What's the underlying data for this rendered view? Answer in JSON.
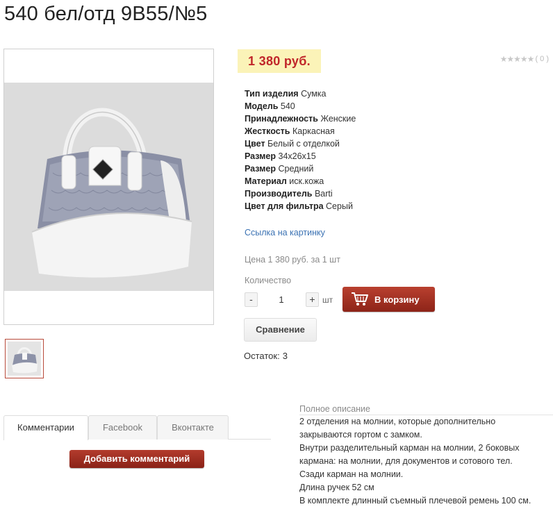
{
  "product": {
    "title": "540 бел/отд 9В55/№5"
  },
  "price": {
    "value": "1 380 руб."
  },
  "rating": {
    "stars": "★★★★★",
    "count": "( 0 )"
  },
  "properties": [
    {
      "name": "Тип изделия",
      "value": "Сумка"
    },
    {
      "name": "Модель",
      "value": "540"
    },
    {
      "name": "Принадлежность",
      "value": "Женские"
    },
    {
      "name": "Жесткость",
      "value": "Каркасная"
    },
    {
      "name": "Цвет",
      "value": "Белый с отделкой"
    },
    {
      "name": "Размер",
      "value": "34x26x15"
    },
    {
      "name": "Размер",
      "value": "Средний"
    },
    {
      "name": "Материал",
      "value": "иск.кожа"
    },
    {
      "name": "Производитель",
      "value": "Barti"
    },
    {
      "name": "Цвет для фильтра",
      "value": "Серый"
    }
  ],
  "links": {
    "image_link": "Ссылка на картинку"
  },
  "purchase": {
    "unit_price": "Цена 1 380 руб. за 1 шт",
    "quantity_label": "Количество",
    "minus": "-",
    "plus": "+",
    "quantity": "1",
    "unit": "шт",
    "cart_button": "В корзину",
    "compare_button": "Сравнение",
    "stock_label": "Остаток:",
    "stock_value": "3"
  },
  "tabs": [
    {
      "label": "Комментарии",
      "active": true
    },
    {
      "label": "Facebook",
      "active": false
    },
    {
      "label": "Вконтакте",
      "active": false
    }
  ],
  "comments": {
    "add_button": "Добавить комментарий"
  },
  "description": {
    "title": "Полное описание",
    "lines": [
      "2 отделения на молнии, которые дополнительно",
      "закрываются гортом с замком.",
      "Внутри разделительный карман на молнии, 2 боковых",
      "кармана: на молнии, для документов и сотового тел.",
      "Сзади карман на молнии.",
      "Длина ручек 52 см",
      "В комплекте длинный съемный плечевой ремень 100 см."
    ]
  },
  "colors": {
    "price_bg": "#fbf3b8",
    "price_text": "#c0262a",
    "cart_button": "#a3301f",
    "link": "#3b72b3"
  },
  "icons": {
    "cart": "shopping-cart-icon",
    "rating": "star-icon"
  }
}
